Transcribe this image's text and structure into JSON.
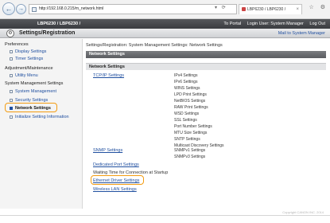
{
  "browser": {
    "url": "http://192.168.0.215/m_network.html",
    "tab_title": "LBP6230 / LBP6230 /",
    "close_glyph": "×",
    "window_icons": "☆ ⚙",
    "back_glyph": "←",
    "forward_glyph": "→",
    "addr_tools": "▾ ⟳"
  },
  "header": {
    "device_name": "LBP6230 / LBP6230 /",
    "links": [
      "To Portal",
      "Login User: System Manager",
      "Log Out"
    ],
    "page_title": "Settings/Registration",
    "mail_link": "Mail to System Manager",
    "title_icon_glyph": "⚙"
  },
  "sidebar": {
    "groups": [
      {
        "heading": "Preferences",
        "items": [
          "Display Settings",
          "Timer Settings"
        ]
      },
      {
        "heading": "Adjustment/Maintenance",
        "items": [
          "Utility Menu"
        ]
      },
      {
        "heading": "System Management Settings",
        "items": [
          "System Management",
          "Security Settings",
          "Network Settings",
          "Initialize Setting Information"
        ]
      }
    ],
    "active_item": "Network Settings"
  },
  "main": {
    "breadcrumb": "Settings/Registration: System Management Settings: Network Settings",
    "section_title": "Network Settings",
    "sub_title": "Network Settings",
    "tcpip": {
      "label": "TCP/IP Settings",
      "options": [
        "IPv4 Settings",
        "IPv6 Settings",
        "WINS Settings",
        "LPD Print Settings",
        "NetBIOS Settings",
        "RAW Print Settings",
        "WSD Settings",
        "SSL Settings",
        "Port Number Settings",
        "MTU Size Settings",
        "SNTP Settings",
        "Multicast Discovery Settings"
      ]
    },
    "snmp": {
      "label": "SNMP Settings",
      "options": [
        "SNMPv1 Settings",
        "SNMPv3 Settings"
      ]
    },
    "dedicated_port": "Dedicated Port Settings",
    "waiting_time": "Waiting Time for Connection at Startup",
    "ethernet": "Ethernet Driver Settings",
    "wireless": "Wireless LAN Settings"
  },
  "footer": {
    "copyright": "Copyright CANON INC. 2014"
  },
  "colors": {
    "accent_ring": "#f39c12",
    "link": "#2150a0",
    "header_bg": "#3a3c40"
  }
}
